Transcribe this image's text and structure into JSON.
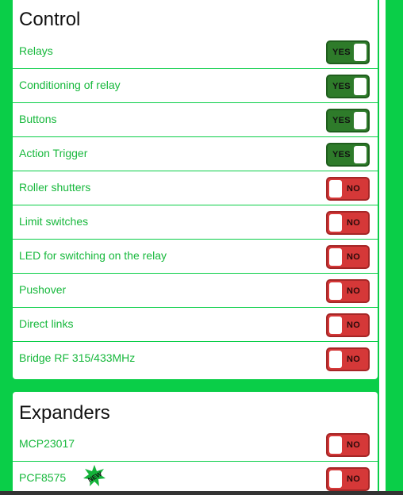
{
  "control": {
    "title": "Control",
    "rows": [
      {
        "label": "Relays",
        "state": "YES"
      },
      {
        "label": "Conditioning of relay",
        "state": "YES"
      },
      {
        "label": "Buttons",
        "state": "YES"
      },
      {
        "label": "Action Trigger",
        "state": "YES"
      },
      {
        "label": "Roller shutters",
        "state": "NO"
      },
      {
        "label": "Limit switches",
        "state": "NO"
      },
      {
        "label": "LED for switching on the relay",
        "state": "NO"
      },
      {
        "label": "Pushover",
        "state": "NO"
      },
      {
        "label": "Direct links",
        "state": "NO"
      },
      {
        "label": "Bridge RF 315/433MHz",
        "state": "NO"
      }
    ]
  },
  "expanders": {
    "title": "Expanders",
    "rows": [
      {
        "label": "MCP23017",
        "state": "NO"
      },
      {
        "label": "PCF8575",
        "state": "NO",
        "badge": "NEW"
      }
    ]
  },
  "colors": {
    "background": "#0ace48",
    "label": "#17b83c",
    "toggle_on": "#2e7b2a",
    "toggle_off": "#d53838"
  },
  "icons": {
    "new_badge": "new-starburst-icon"
  }
}
